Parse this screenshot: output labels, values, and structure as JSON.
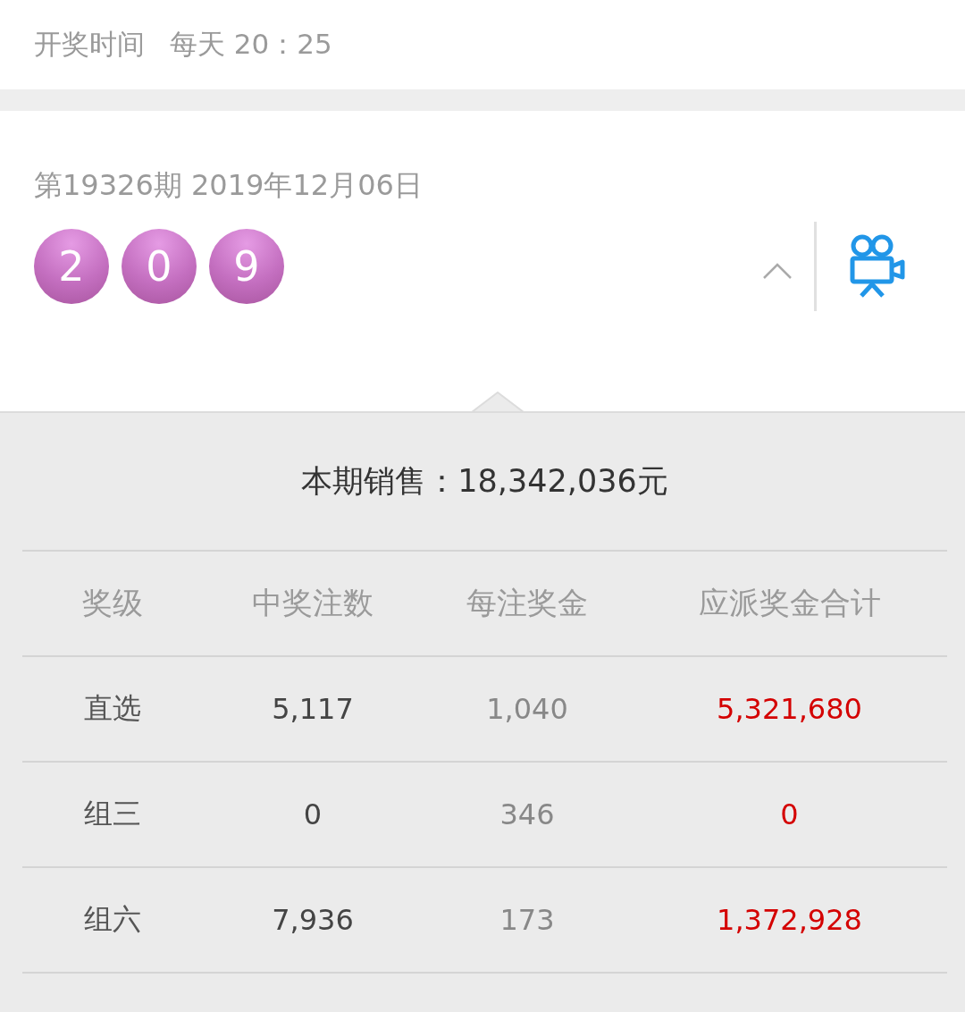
{
  "schedule": {
    "label": "开奖时间",
    "value": "每天 20：25"
  },
  "draw": {
    "issue": "第19326期 2019年12月06日",
    "numbers": [
      "2",
      "0",
      "9"
    ],
    "expanded": true
  },
  "detail": {
    "sales": "本期销售：18,342,036元",
    "columns": [
      "奖级",
      "中奖注数",
      "每注奖金",
      "应派奖金合计"
    ],
    "rows": [
      {
        "cells": [
          "直选",
          "5,117",
          "1,040",
          "5,321,680"
        ]
      },
      {
        "cells": [
          "组三",
          "0",
          "346",
          "0"
        ]
      },
      {
        "cells": [
          "组六",
          "7,936",
          "173",
          "1,372,928"
        ]
      }
    ]
  }
}
